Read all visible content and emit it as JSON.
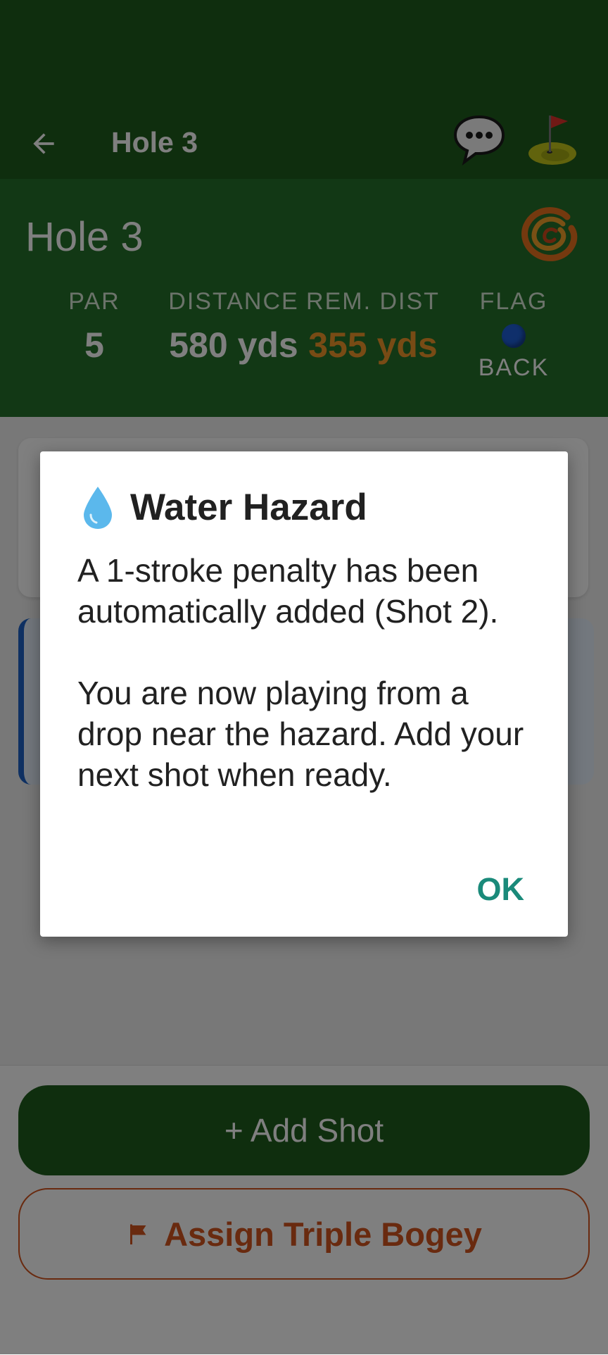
{
  "app_bar": {
    "title": "Hole 3"
  },
  "hole_header": {
    "title": "Hole 3",
    "stats": {
      "par": {
        "label": "PAR",
        "value": "5"
      },
      "distance": {
        "label": "DISTANCE",
        "value": "580 yds"
      },
      "remaining": {
        "label": "REM. DIST",
        "value": "355 yds"
      },
      "flag": {
        "label": "FLAG",
        "position": "BACK"
      }
    }
  },
  "actions": {
    "add_shot": "+ Add Shot",
    "assign_triple_bogey": "Assign Triple Bogey"
  },
  "dialog": {
    "title": "Water Hazard",
    "body_line1": "A 1-stroke penalty has been automatically added (Shot 2).",
    "body_line2": "You are now playing from a drop near the hazard. Add your next shot when ready.",
    "ok_label": "OK"
  },
  "icons": {
    "back": "arrow-left-icon",
    "chat": "speech-bubble-icon",
    "course": "golf-green-flag-icon",
    "brand": "swirl-logo-icon",
    "flag_indicator": "blue-dot-icon",
    "dialog_title": "water-drop-icon",
    "triple_bogey": "flag-icon"
  },
  "colors": {
    "primary_green": "#1f5c1c",
    "header_green": "#25702a",
    "remaining_orange": "#f0962a",
    "danger_orange": "#d2541f",
    "dialog_accent": "#1a8a7a",
    "flag_blue": "#1e5fd6"
  }
}
